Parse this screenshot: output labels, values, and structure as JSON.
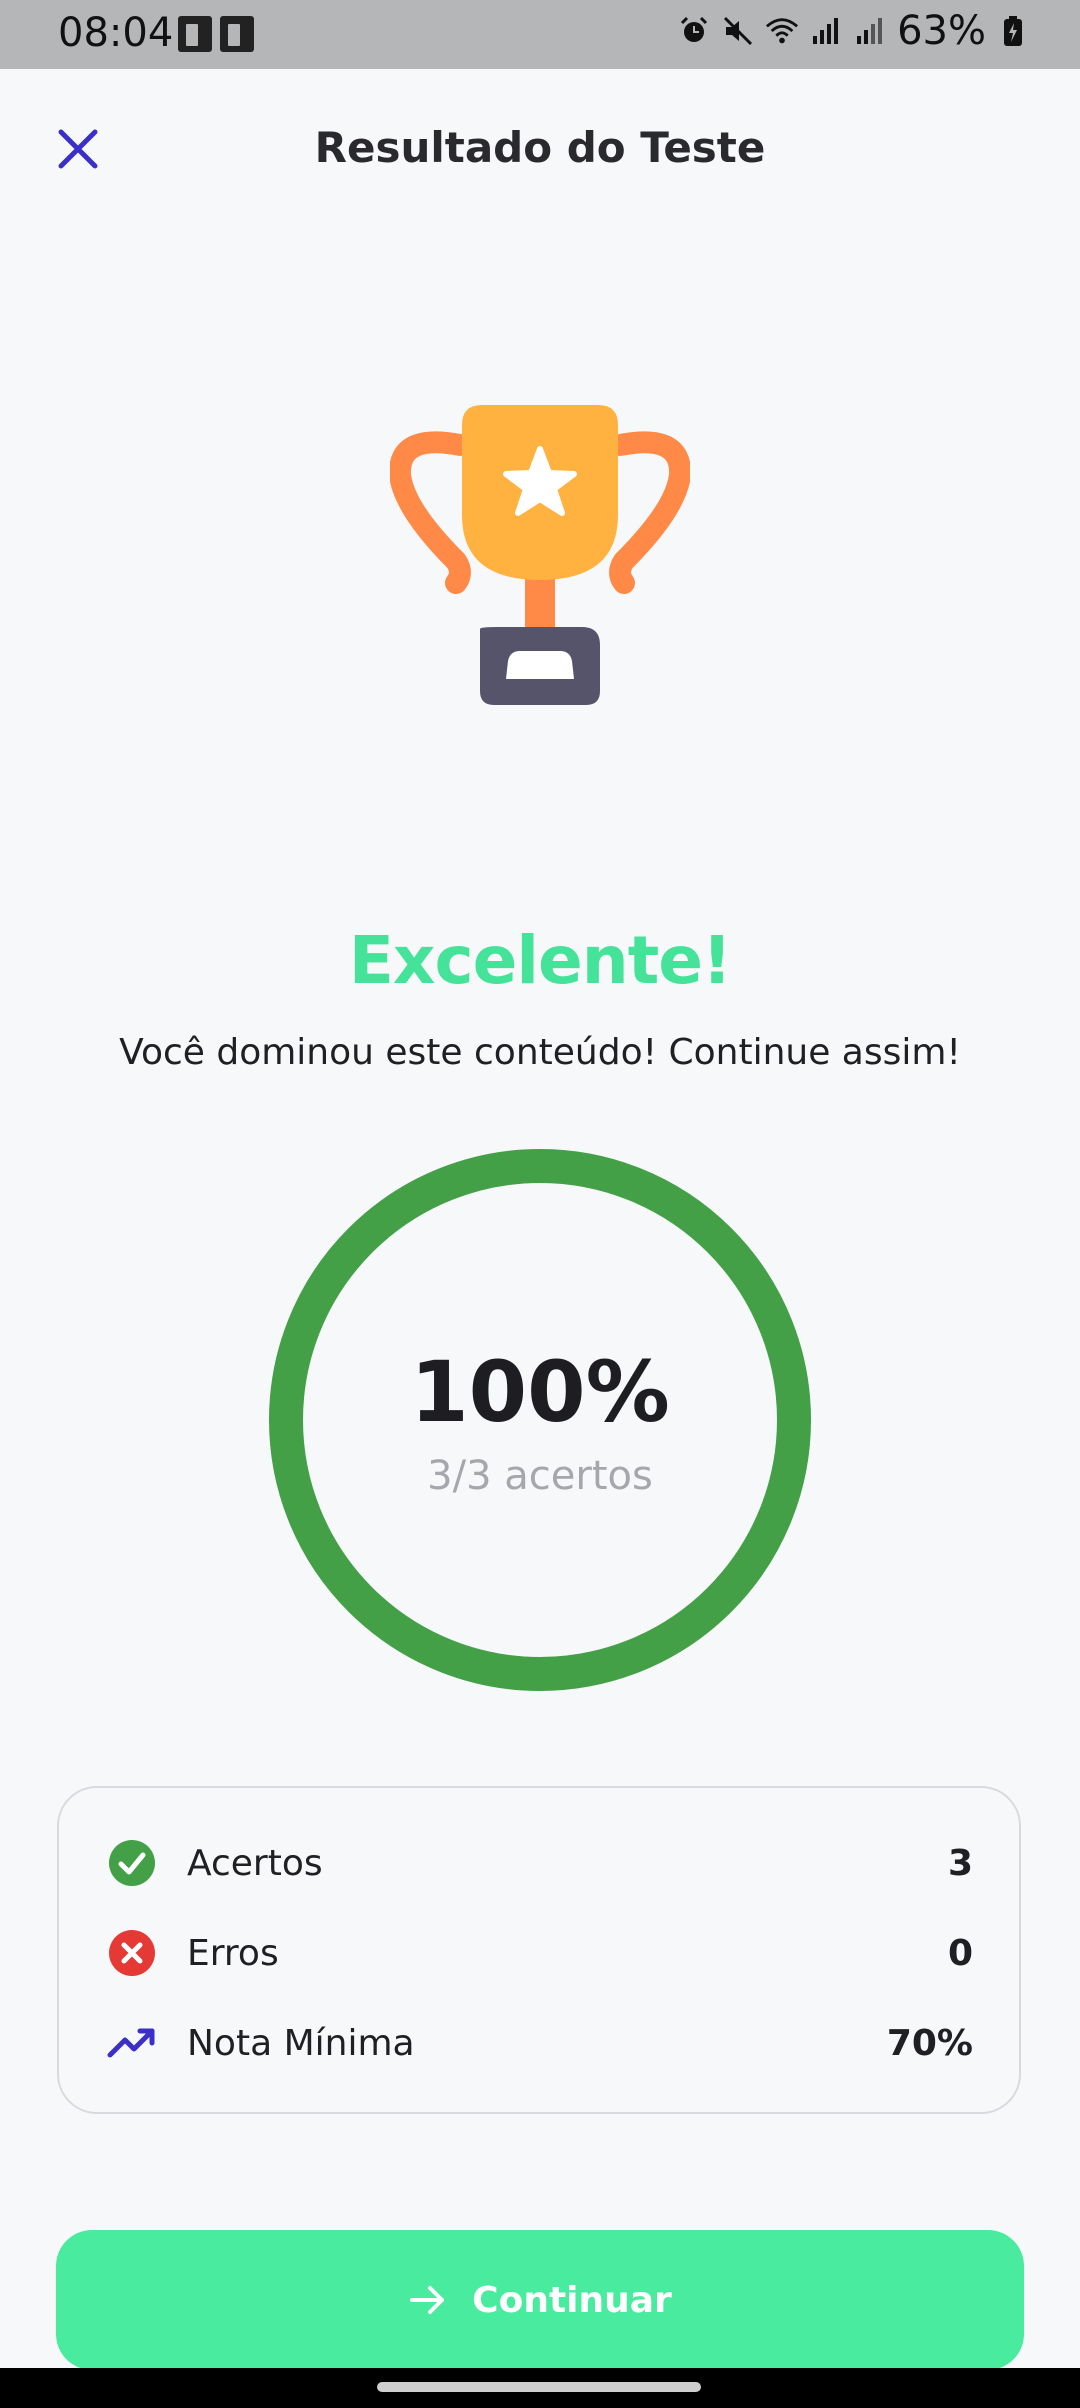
{
  "status_bar": {
    "time": "08:04",
    "battery": "63%"
  },
  "header": {
    "title": "Resultado do Teste",
    "close_icon": "close-icon"
  },
  "result": {
    "title": "Excelente!",
    "message": "Você dominou este conteúdo! Continue assim!",
    "percent_text": "100%",
    "score_text": "3/3 acertos",
    "progress_fraction": 1.0
  },
  "stats": [
    {
      "label": "Acertos",
      "value": "3",
      "icon": "check-circle-icon",
      "color": "#43a047"
    },
    {
      "label": "Erros",
      "value": "0",
      "icon": "x-circle-icon",
      "color": "#e53935"
    },
    {
      "label": "Nota Mínima",
      "value": "70%",
      "icon": "trending-up-icon",
      "color": "#3b2fc9"
    }
  ],
  "continue_button": {
    "label": "Continuar",
    "icon": "arrow-right-icon"
  },
  "colors": {
    "accent": "#45e39a",
    "progress": "#43a047",
    "button": "#49ec9e"
  }
}
